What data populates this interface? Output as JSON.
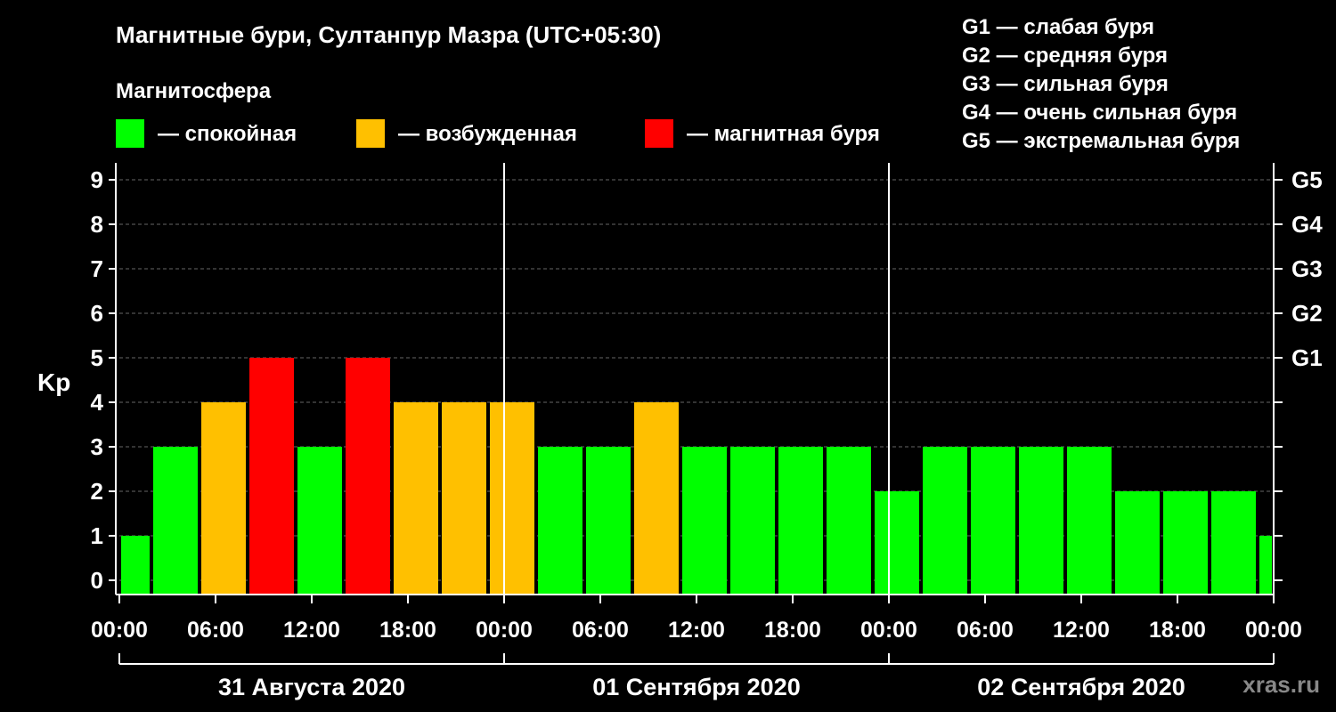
{
  "header": {
    "title": "Магнитные бури, Султанпур Мазра (UTC+05:30)",
    "legend_title": "Магнитосфера",
    "watermark": "xras.ru"
  },
  "legend": [
    {
      "label": "— спокойная",
      "color": "#00ff00"
    },
    {
      "label": "— возбужденная",
      "color": "#ffc000"
    },
    {
      "label": "— магнитная буря",
      "color": "#ff0000"
    }
  ],
  "storm_scale": [
    "G1 — слабая буря",
    "G2 — средняя буря",
    "G3 — сильная буря",
    "G4 — очень сильная буря",
    "G5 — экстремальная буря"
  ],
  "colors": {
    "quiet": "#00ff00",
    "active": "#ffc000",
    "storm": "#ff0000",
    "background": "#000000",
    "axis": "#ffffff"
  },
  "chart_data": {
    "type": "bar",
    "ylabel": "Kp",
    "ylim": [
      0,
      9
    ],
    "yticks": [
      "0",
      "1",
      "2",
      "3",
      "4",
      "5",
      "6",
      "7",
      "8",
      "9"
    ],
    "right_ticks": [
      {
        "kp": 5,
        "label": "G1"
      },
      {
        "kp": 6,
        "label": "G2"
      },
      {
        "kp": 7,
        "label": "G3"
      },
      {
        "kp": 8,
        "label": "G4"
      },
      {
        "kp": 9,
        "label": "G5"
      }
    ],
    "grid": "horizontal dashed",
    "xrange_hours": [
      0,
      72
    ],
    "xticks": [
      {
        "hour": 0,
        "label": "00:00"
      },
      {
        "hour": 6,
        "label": "06:00"
      },
      {
        "hour": 12,
        "label": "12:00"
      },
      {
        "hour": 18,
        "label": "18:00"
      },
      {
        "hour": 24,
        "label": "00:00"
      },
      {
        "hour": 30,
        "label": "06:00"
      },
      {
        "hour": 36,
        "label": "12:00"
      },
      {
        "hour": 42,
        "label": "18:00"
      },
      {
        "hour": 48,
        "label": "00:00"
      },
      {
        "hour": 54,
        "label": "06:00"
      },
      {
        "hour": 60,
        "label": "12:00"
      },
      {
        "hour": 66,
        "label": "18:00"
      },
      {
        "hour": 72,
        "label": "00:00"
      }
    ],
    "days": [
      {
        "label": "31 Августа 2020",
        "start_hour": 0,
        "end_hour": 24
      },
      {
        "label": "01 Сентября 2020",
        "start_hour": 24,
        "end_hour": 48
      },
      {
        "label": "02 Сентября 2020",
        "start_hour": 48,
        "end_hour": 72
      }
    ],
    "bars": [
      {
        "start_hour": 0,
        "end_hour": 2,
        "kp": 1,
        "level": "quiet"
      },
      {
        "start_hour": 2,
        "end_hour": 5,
        "kp": 3,
        "level": "quiet"
      },
      {
        "start_hour": 5,
        "end_hour": 8,
        "kp": 4,
        "level": "active"
      },
      {
        "start_hour": 8,
        "end_hour": 11,
        "kp": 5,
        "level": "storm"
      },
      {
        "start_hour": 11,
        "end_hour": 14,
        "kp": 3,
        "level": "quiet"
      },
      {
        "start_hour": 14,
        "end_hour": 17,
        "kp": 5,
        "level": "storm"
      },
      {
        "start_hour": 17,
        "end_hour": 20,
        "kp": 4,
        "level": "active"
      },
      {
        "start_hour": 20,
        "end_hour": 23,
        "kp": 4,
        "level": "active"
      },
      {
        "start_hour": 23,
        "end_hour": 26,
        "kp": 4,
        "level": "active"
      },
      {
        "start_hour": 26,
        "end_hour": 29,
        "kp": 3,
        "level": "quiet"
      },
      {
        "start_hour": 29,
        "end_hour": 32,
        "kp": 3,
        "level": "quiet"
      },
      {
        "start_hour": 32,
        "end_hour": 35,
        "kp": 4,
        "level": "active"
      },
      {
        "start_hour": 35,
        "end_hour": 38,
        "kp": 3,
        "level": "quiet"
      },
      {
        "start_hour": 38,
        "end_hour": 41,
        "kp": 3,
        "level": "quiet"
      },
      {
        "start_hour": 41,
        "end_hour": 44,
        "kp": 3,
        "level": "quiet"
      },
      {
        "start_hour": 44,
        "end_hour": 47,
        "kp": 3,
        "level": "quiet"
      },
      {
        "start_hour": 47,
        "end_hour": 50,
        "kp": 2,
        "level": "quiet"
      },
      {
        "start_hour": 50,
        "end_hour": 53,
        "kp": 3,
        "level": "quiet"
      },
      {
        "start_hour": 53,
        "end_hour": 56,
        "kp": 3,
        "level": "quiet"
      },
      {
        "start_hour": 56,
        "end_hour": 59,
        "kp": 3,
        "level": "quiet"
      },
      {
        "start_hour": 59,
        "end_hour": 62,
        "kp": 3,
        "level": "quiet"
      },
      {
        "start_hour": 62,
        "end_hour": 65,
        "kp": 2,
        "level": "quiet"
      },
      {
        "start_hour": 65,
        "end_hour": 68,
        "kp": 2,
        "level": "quiet"
      },
      {
        "start_hour": 68,
        "end_hour": 71,
        "kp": 2,
        "level": "quiet"
      },
      {
        "start_hour": 71,
        "end_hour": 72,
        "kp": 1,
        "level": "quiet"
      }
    ]
  }
}
